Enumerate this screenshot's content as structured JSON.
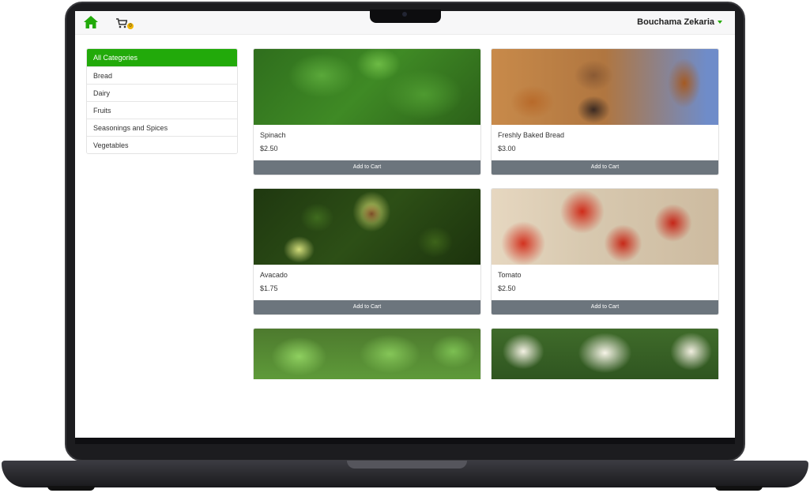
{
  "navbar": {
    "home_icon": "home-icon",
    "cart_icon": "cart-icon",
    "cart_count": "0",
    "user_name": "Bouchama Zekaria",
    "accent_color": "#22aa0a"
  },
  "sidebar": {
    "items": [
      {
        "label": "All Categories",
        "active": true
      },
      {
        "label": "Bread"
      },
      {
        "label": "Dairy"
      },
      {
        "label": "Fruits"
      },
      {
        "label": "Seasonings and Spices"
      },
      {
        "label": "Vegetables"
      }
    ]
  },
  "products": [
    {
      "name": "Spinach",
      "price": "$2.50",
      "button": "Add to Cart"
    },
    {
      "name": "Freshly Baked Bread",
      "price": "$3.00",
      "button": "Add to Cart"
    },
    {
      "name": "Avacado",
      "price": "$1.75",
      "button": "Add to Cart"
    },
    {
      "name": "Tomato",
      "price": "$2.50",
      "button": "Add to Cart"
    }
  ]
}
